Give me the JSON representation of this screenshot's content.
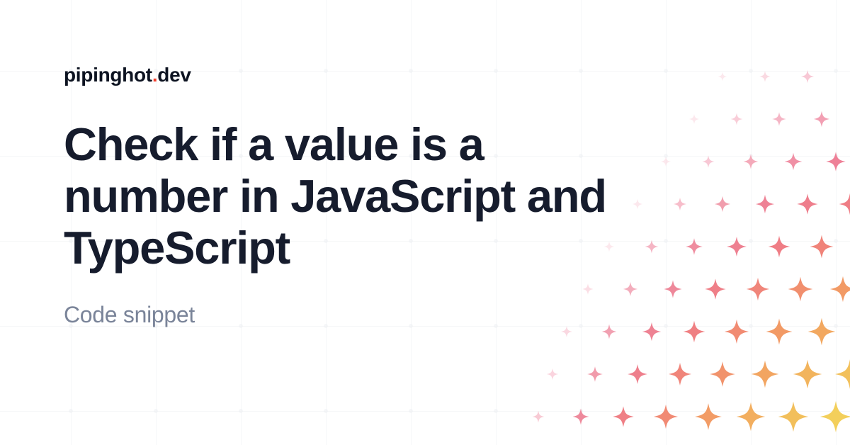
{
  "brand": {
    "name": "pipinghot",
    "dot": ".",
    "tld": "dev"
  },
  "title": "Check if a value is a number in JavaScript and TypeScript",
  "subtitle": "Code snippet",
  "colors": {
    "text_primary": "#161c2d",
    "text_muted": "#7a8499",
    "accent_red": "#f43f2e",
    "sparkle_pink": "#f4a7b8",
    "sparkle_orange": "#f2a15a",
    "sparkle_yellow": "#f3cf5b"
  }
}
